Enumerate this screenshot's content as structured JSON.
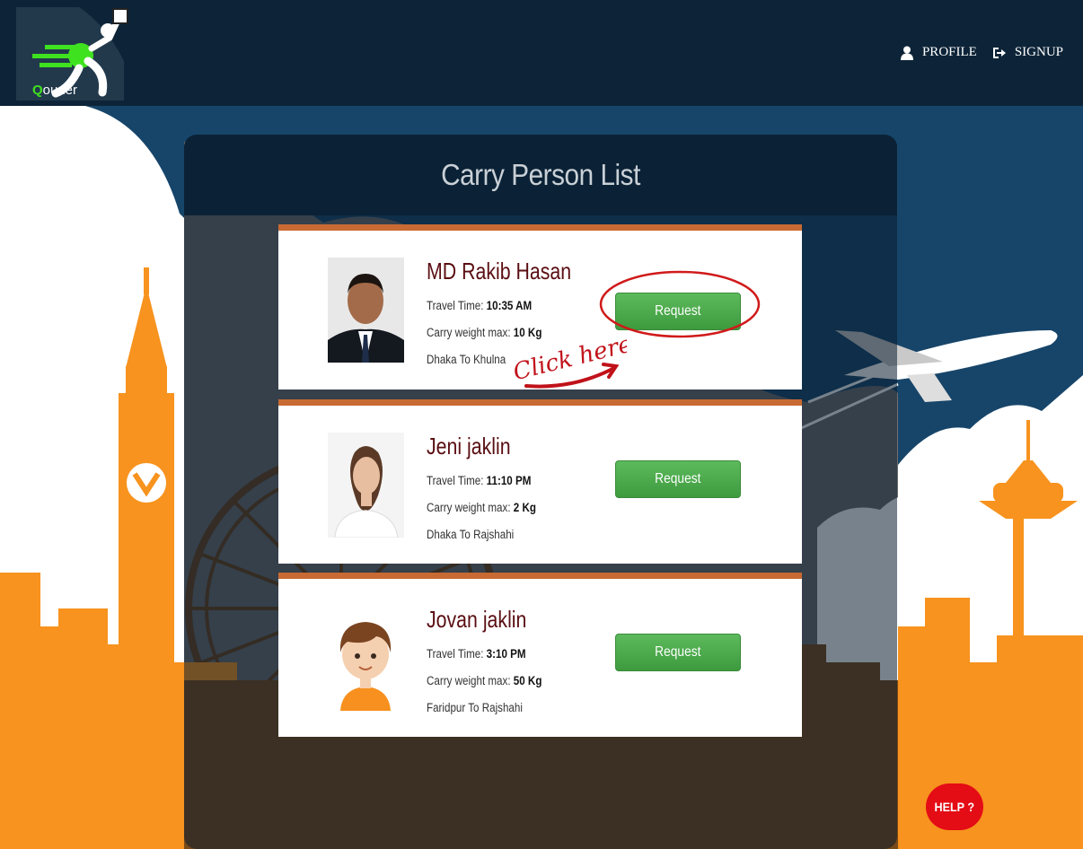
{
  "app": {
    "logo_text_q": "Q",
    "logo_text_rest": "ourier",
    "logo_icon": "running-courier-icon"
  },
  "nav": {
    "profile_label": "PROFILE",
    "profile_icon": "user-icon",
    "signup_label": "SIGNUP",
    "signup_icon": "sign-in-icon"
  },
  "page": {
    "title": "Carry Person List"
  },
  "persons": [
    {
      "name": "MD Rakib Hasan",
      "travel_time_label": "Travel Time:",
      "travel_time": "10:35 AM",
      "weight_label": "Carry weight max:",
      "weight": "10 Kg",
      "route": "Dhaka To Khulna",
      "button_label": "Request"
    },
    {
      "name": "Jeni jaklin",
      "travel_time_label": "Travel Time:",
      "travel_time": "11:10 PM",
      "weight_label": "Carry weight max:",
      "weight": "2 Kg",
      "route": "Dhaka To Rajshahi",
      "button_label": "Request"
    },
    {
      "name": "Jovan jaklin",
      "travel_time_label": "Travel Time:",
      "travel_time": "3:10 PM",
      "weight_label": "Carry weight max:",
      "weight": "50 Kg",
      "route": "Faridpur To Rajshahi",
      "button_label": "Request"
    }
  ],
  "annotation": {
    "text": "Click here"
  },
  "help": {
    "label": "HELP ?"
  },
  "colors": {
    "topbar": "#0d2438",
    "sky": "#17456a",
    "orange": "#f7931e",
    "card_accent": "#c86a33",
    "name": "#5a0e12",
    "button_green": "#4cae4c",
    "help_red": "#e40c15",
    "annotation_red": "#d01a1a",
    "logo_green": "#3fe21f"
  }
}
